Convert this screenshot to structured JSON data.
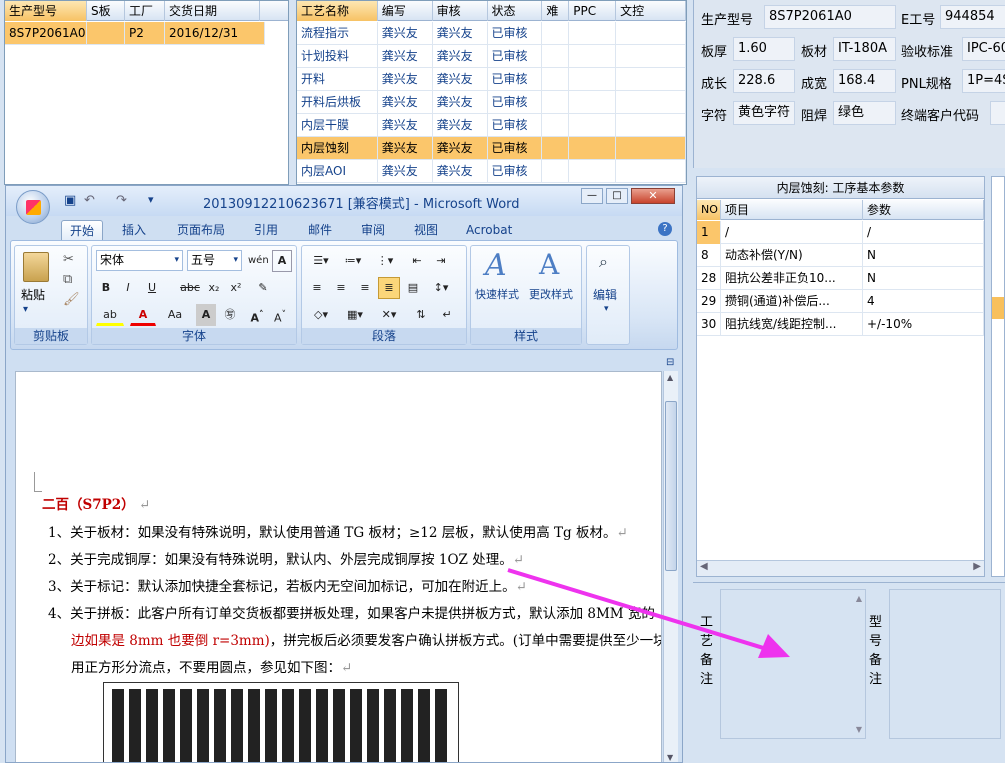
{
  "top_left_grid": {
    "headers": [
      "生产型号",
      "S板",
      "工厂",
      "交货日期"
    ],
    "rows": [
      [
        "8S7P2061A0",
        "",
        "P2",
        "2016/12/31"
      ]
    ]
  },
  "process_grid": {
    "headers": [
      "工艺名称",
      "编写",
      "审核",
      "状态",
      "难",
      "PPC",
      "文控"
    ],
    "rows": [
      [
        "流程指示",
        "龚兴友",
        "龚兴友",
        "已审核"
      ],
      [
        "计划投料",
        "龚兴友",
        "龚兴友",
        "已审核"
      ],
      [
        "开料",
        "龚兴友",
        "龚兴友",
        "已审核"
      ],
      [
        "开料后烘板",
        "龚兴友",
        "龚兴友",
        "已审核"
      ],
      [
        "内层干膜",
        "龚兴友",
        "龚兴友",
        "已审核"
      ],
      [
        "内层蚀刻",
        "龚兴友",
        "龚兴友",
        "已审核"
      ],
      [
        "内层AOI",
        "龚兴友",
        "龚兴友",
        "已审核"
      ]
    ]
  },
  "info_panel": {
    "model_label": "生产型号",
    "model": "8S7P2061A0",
    "e_label": "E工号",
    "e_value": "944854",
    "thickness_label": "板厚",
    "thickness": "1.60",
    "material_label": "板材",
    "material": "IT-180A",
    "standard_label": "验收标准",
    "standard": "IPC-60",
    "length_label": "成长",
    "length": "228.6",
    "width_label": "成宽",
    "width": "168.4",
    "pnl_label": "PNL规格",
    "pnl": "1P=4S",
    "char_label": "字符",
    "char": "黄色字符",
    "mask_label": "阻焊",
    "mask": "绿色",
    "customer_label": "终端客户代码",
    "customer": ""
  },
  "param_grid": {
    "title": "内层蚀刻: 工序基本参数",
    "headers": [
      "NO",
      "项目",
      "参数"
    ],
    "rows": [
      [
        "1",
        "/",
        "/"
      ],
      [
        "8",
        "动态补偿(Y/N)",
        "N"
      ],
      [
        "28",
        "阻抗公差非正负10...",
        "N"
      ],
      [
        "29",
        "攒铜(通道)补偿后...",
        "4"
      ],
      [
        "30",
        "阻抗线宽/线距控制...",
        "+/-10%"
      ]
    ]
  },
  "remarks": {
    "process_label": "工艺备注",
    "model_label": "型号备注"
  },
  "word": {
    "title": "20130912210623671 [兼容模式] - Microsoft Word",
    "tabs": [
      "开始",
      "插入",
      "页面布局",
      "引用",
      "邮件",
      "审阅",
      "视图",
      "Acrobat"
    ],
    "groups": {
      "clipboard": "剪贴板",
      "font": "字体",
      "paragraph": "段落",
      "styles": "样式"
    },
    "paste": "粘贴",
    "font_name": "宋体",
    "font_size": "五号",
    "quick_style": "快速样式",
    "change_style": "更改样式",
    "edit": "编辑",
    "doc": {
      "heading": "二百（S7P2）",
      "l1": "1、关于板材：如果没有特殊说明，默认使用普通 TG 板材；≥12 层板，默认使用高 Tg 板材。",
      "l2": "2、关于完成铜厚：如果没有特殊说明，默认内、外层完成铜厚按 1OZ 处理。",
      "l3": "3、关于标记：默认添加快捷全套标记，若板内无空间加标记，可加在附近上。",
      "l4": "4、关于拼板：此客户所有订单交货板都要拼板处理，如果客户未提供拼板方式，默认添加 8MM 宽的",
      "l5_red": "边如果是 8mm 也要倒 r=3mm)",
      "l5_rest": "，拼完板后必须要发客户确认拼板方式。(订单中需要提供至少一块",
      "l6": "用正方形分流点，不要用圆点，参见如下图："
    }
  },
  "colors": {
    "arrow": "#ee33ee",
    "selected": "#fbc66b",
    "accent": "#15428b",
    "red_text": "#c00000"
  }
}
